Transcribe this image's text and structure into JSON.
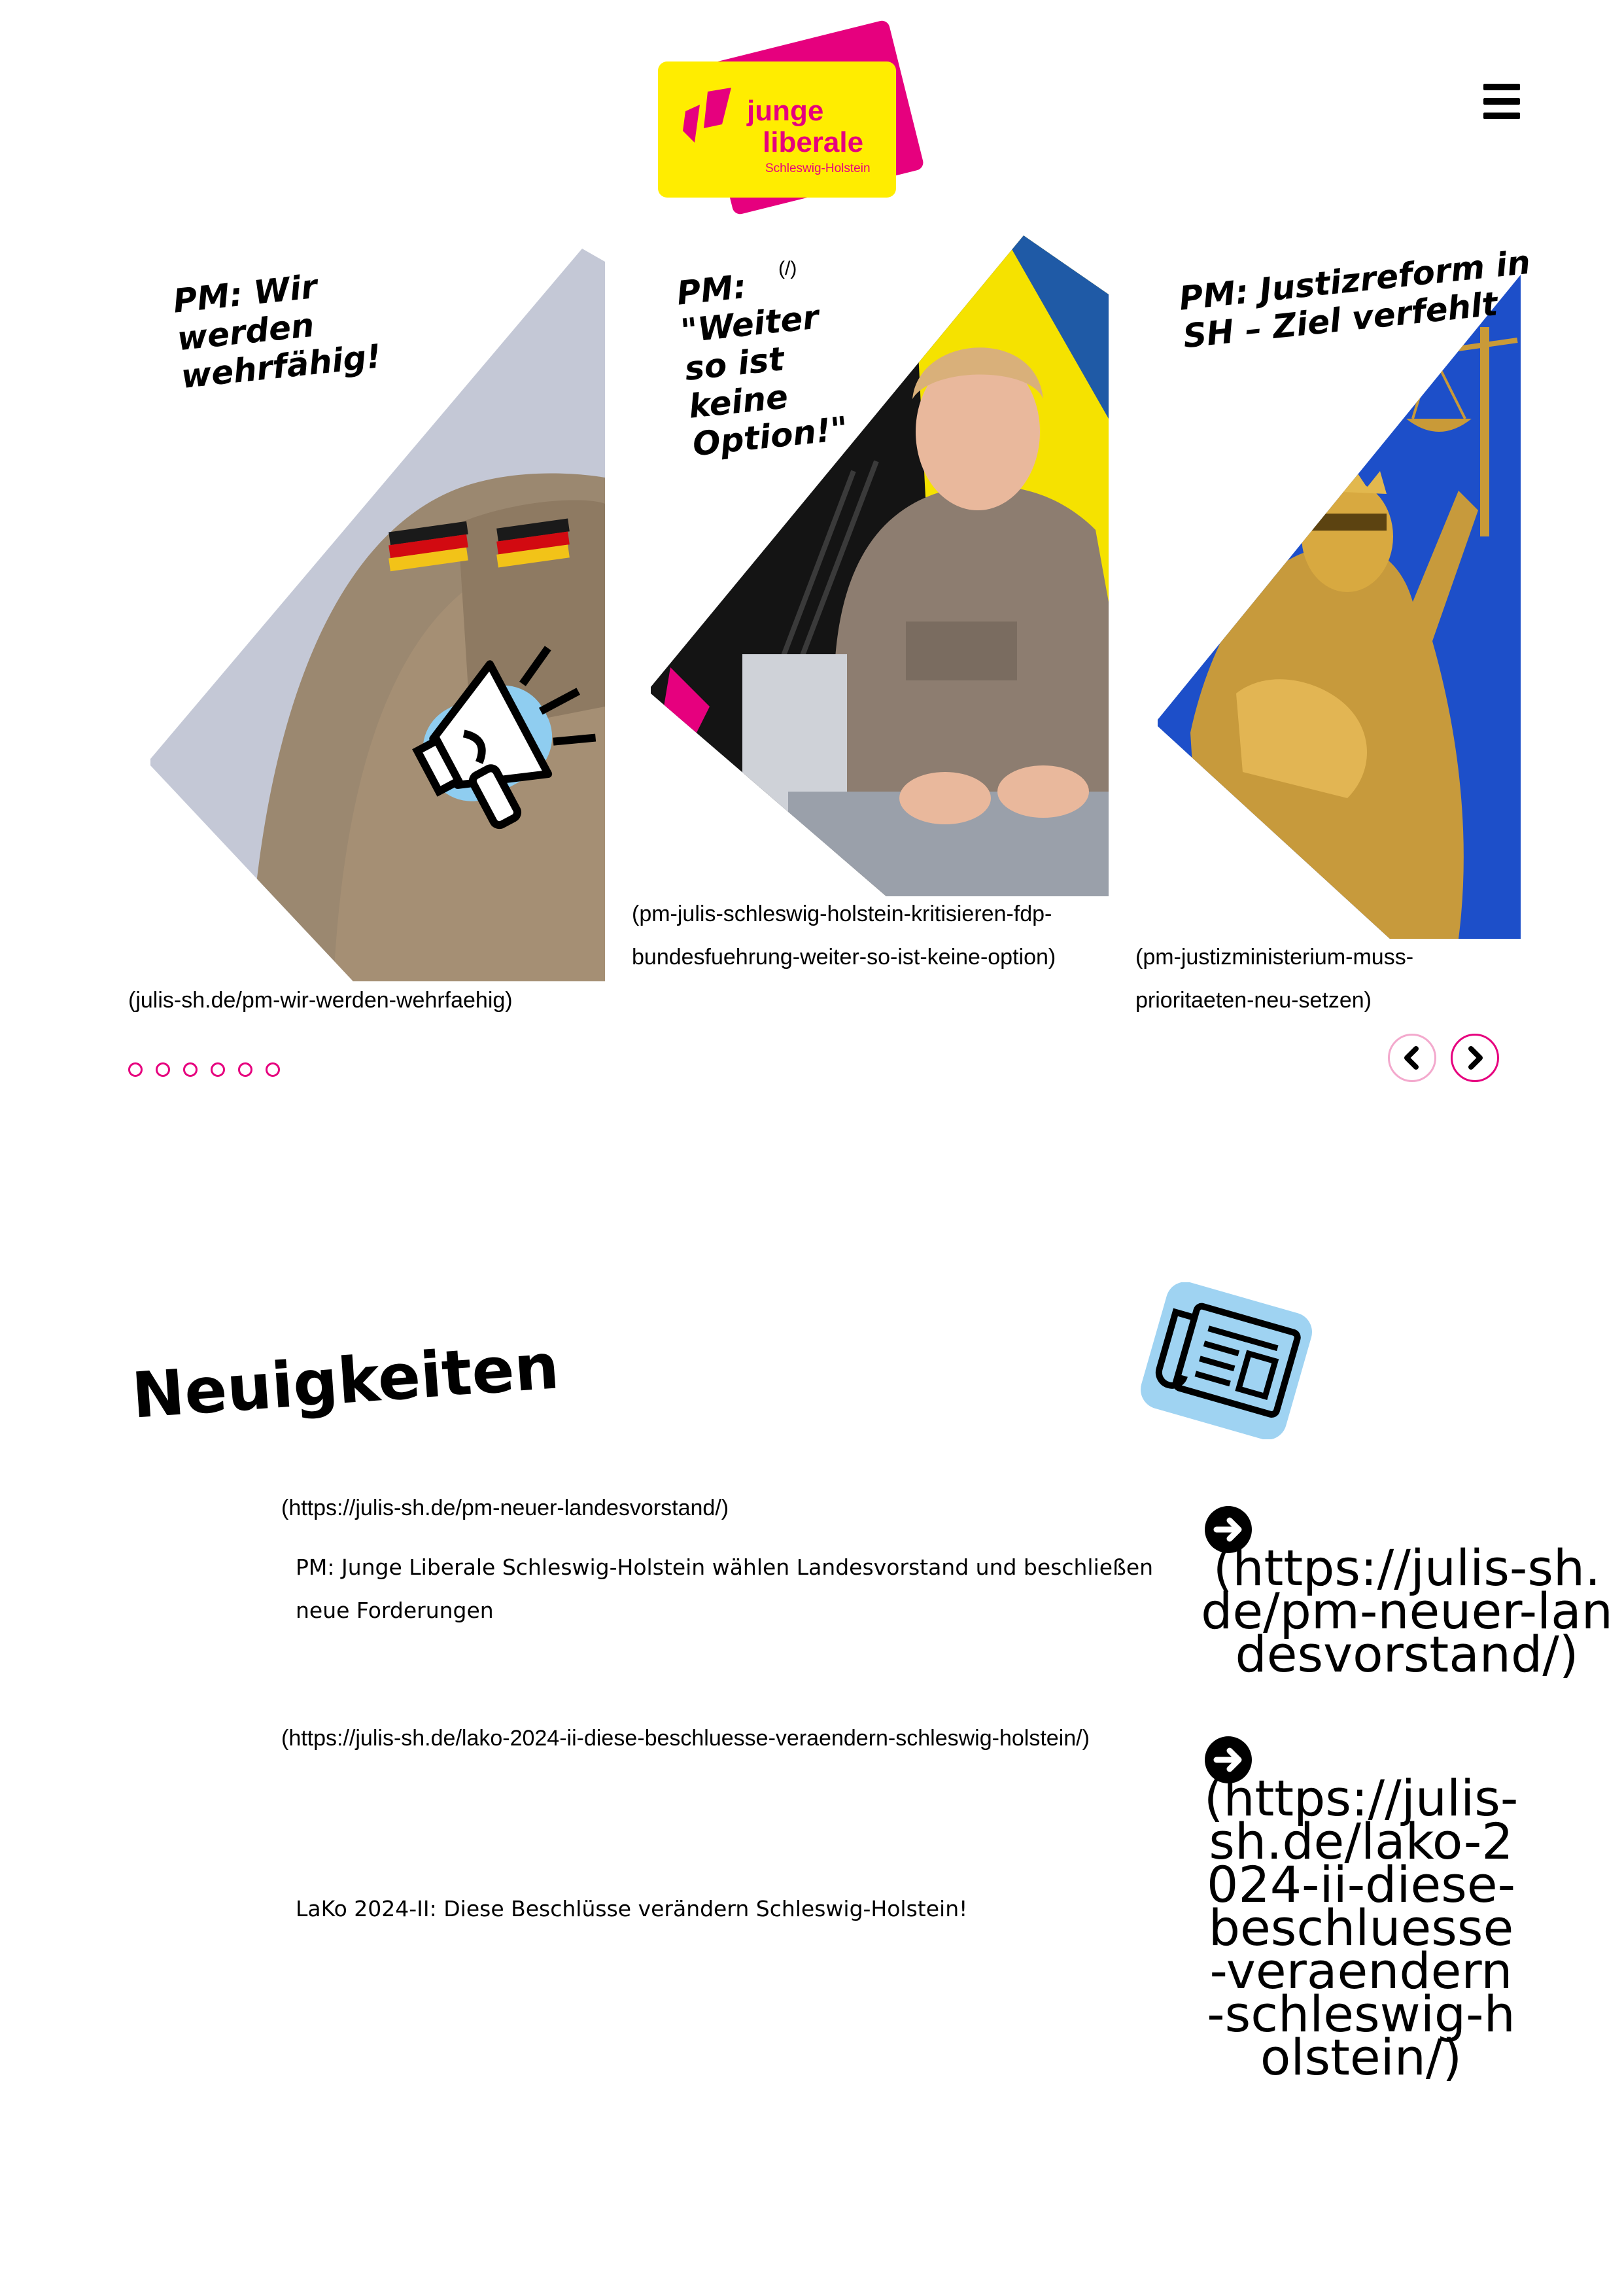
{
  "header": {
    "logo": {
      "line1": "junge",
      "line2": "liberale",
      "line3": "Schleswig-Holstein"
    },
    "menu_icon": "hamburger-icon",
    "home_link": "(/)"
  },
  "carousel": {
    "slides": [
      {
        "title": "PM: Wir werden\nwehrfähig!",
        "link": "(julis-sh.de/pm-wir-werden-wehrfaehig)"
      },
      {
        "title": "PM: \"Weiter so ist\nkeine Option!\"",
        "link": "(pm-julis-schleswig-holstein-kritisieren-fdp-bundesfuehrung-weiter-so-ist-keine-option)"
      },
      {
        "title": "PM: Justizreform in\nSH – Ziel verfehlt",
        "link": "(pm-justizministerium-muss-prioritaeten-neu-setzen)"
      }
    ],
    "dots_count": 6,
    "prev_icon": "chevron-left-icon",
    "next_icon": "chevron-right-icon"
  },
  "news": {
    "heading": "Neuigkeiten",
    "icon": "newspaper-icon",
    "items": [
      {
        "link": "(https://julis-sh.de/pm-neuer-landesvorstand/)",
        "text": "PM: Junge Liberale Schleswig-Holstein wählen Landesvorstand und beschließen neue Forderungen",
        "big_link": "(https://julis-sh.de/pm-neuer-landesvorstand/)"
      },
      {
        "link": "(https://julis-sh.de/lako-2024-ii-diese-beschluesse-veraendern-schleswig-holstein/)",
        "text": "LaKo 2024-II: Diese Beschlüsse verändern Schleswig-Holstein!",
        "big_link": "(https://julis-sh.de/lako-2024-ii-diese-beschluesse-veraendern-schleswig-holstein/)"
      }
    ]
  },
  "colors": {
    "brand_pink": "#e6007e",
    "brand_yellow": "#ffed00",
    "icon_blue": "#9fd3f2"
  }
}
